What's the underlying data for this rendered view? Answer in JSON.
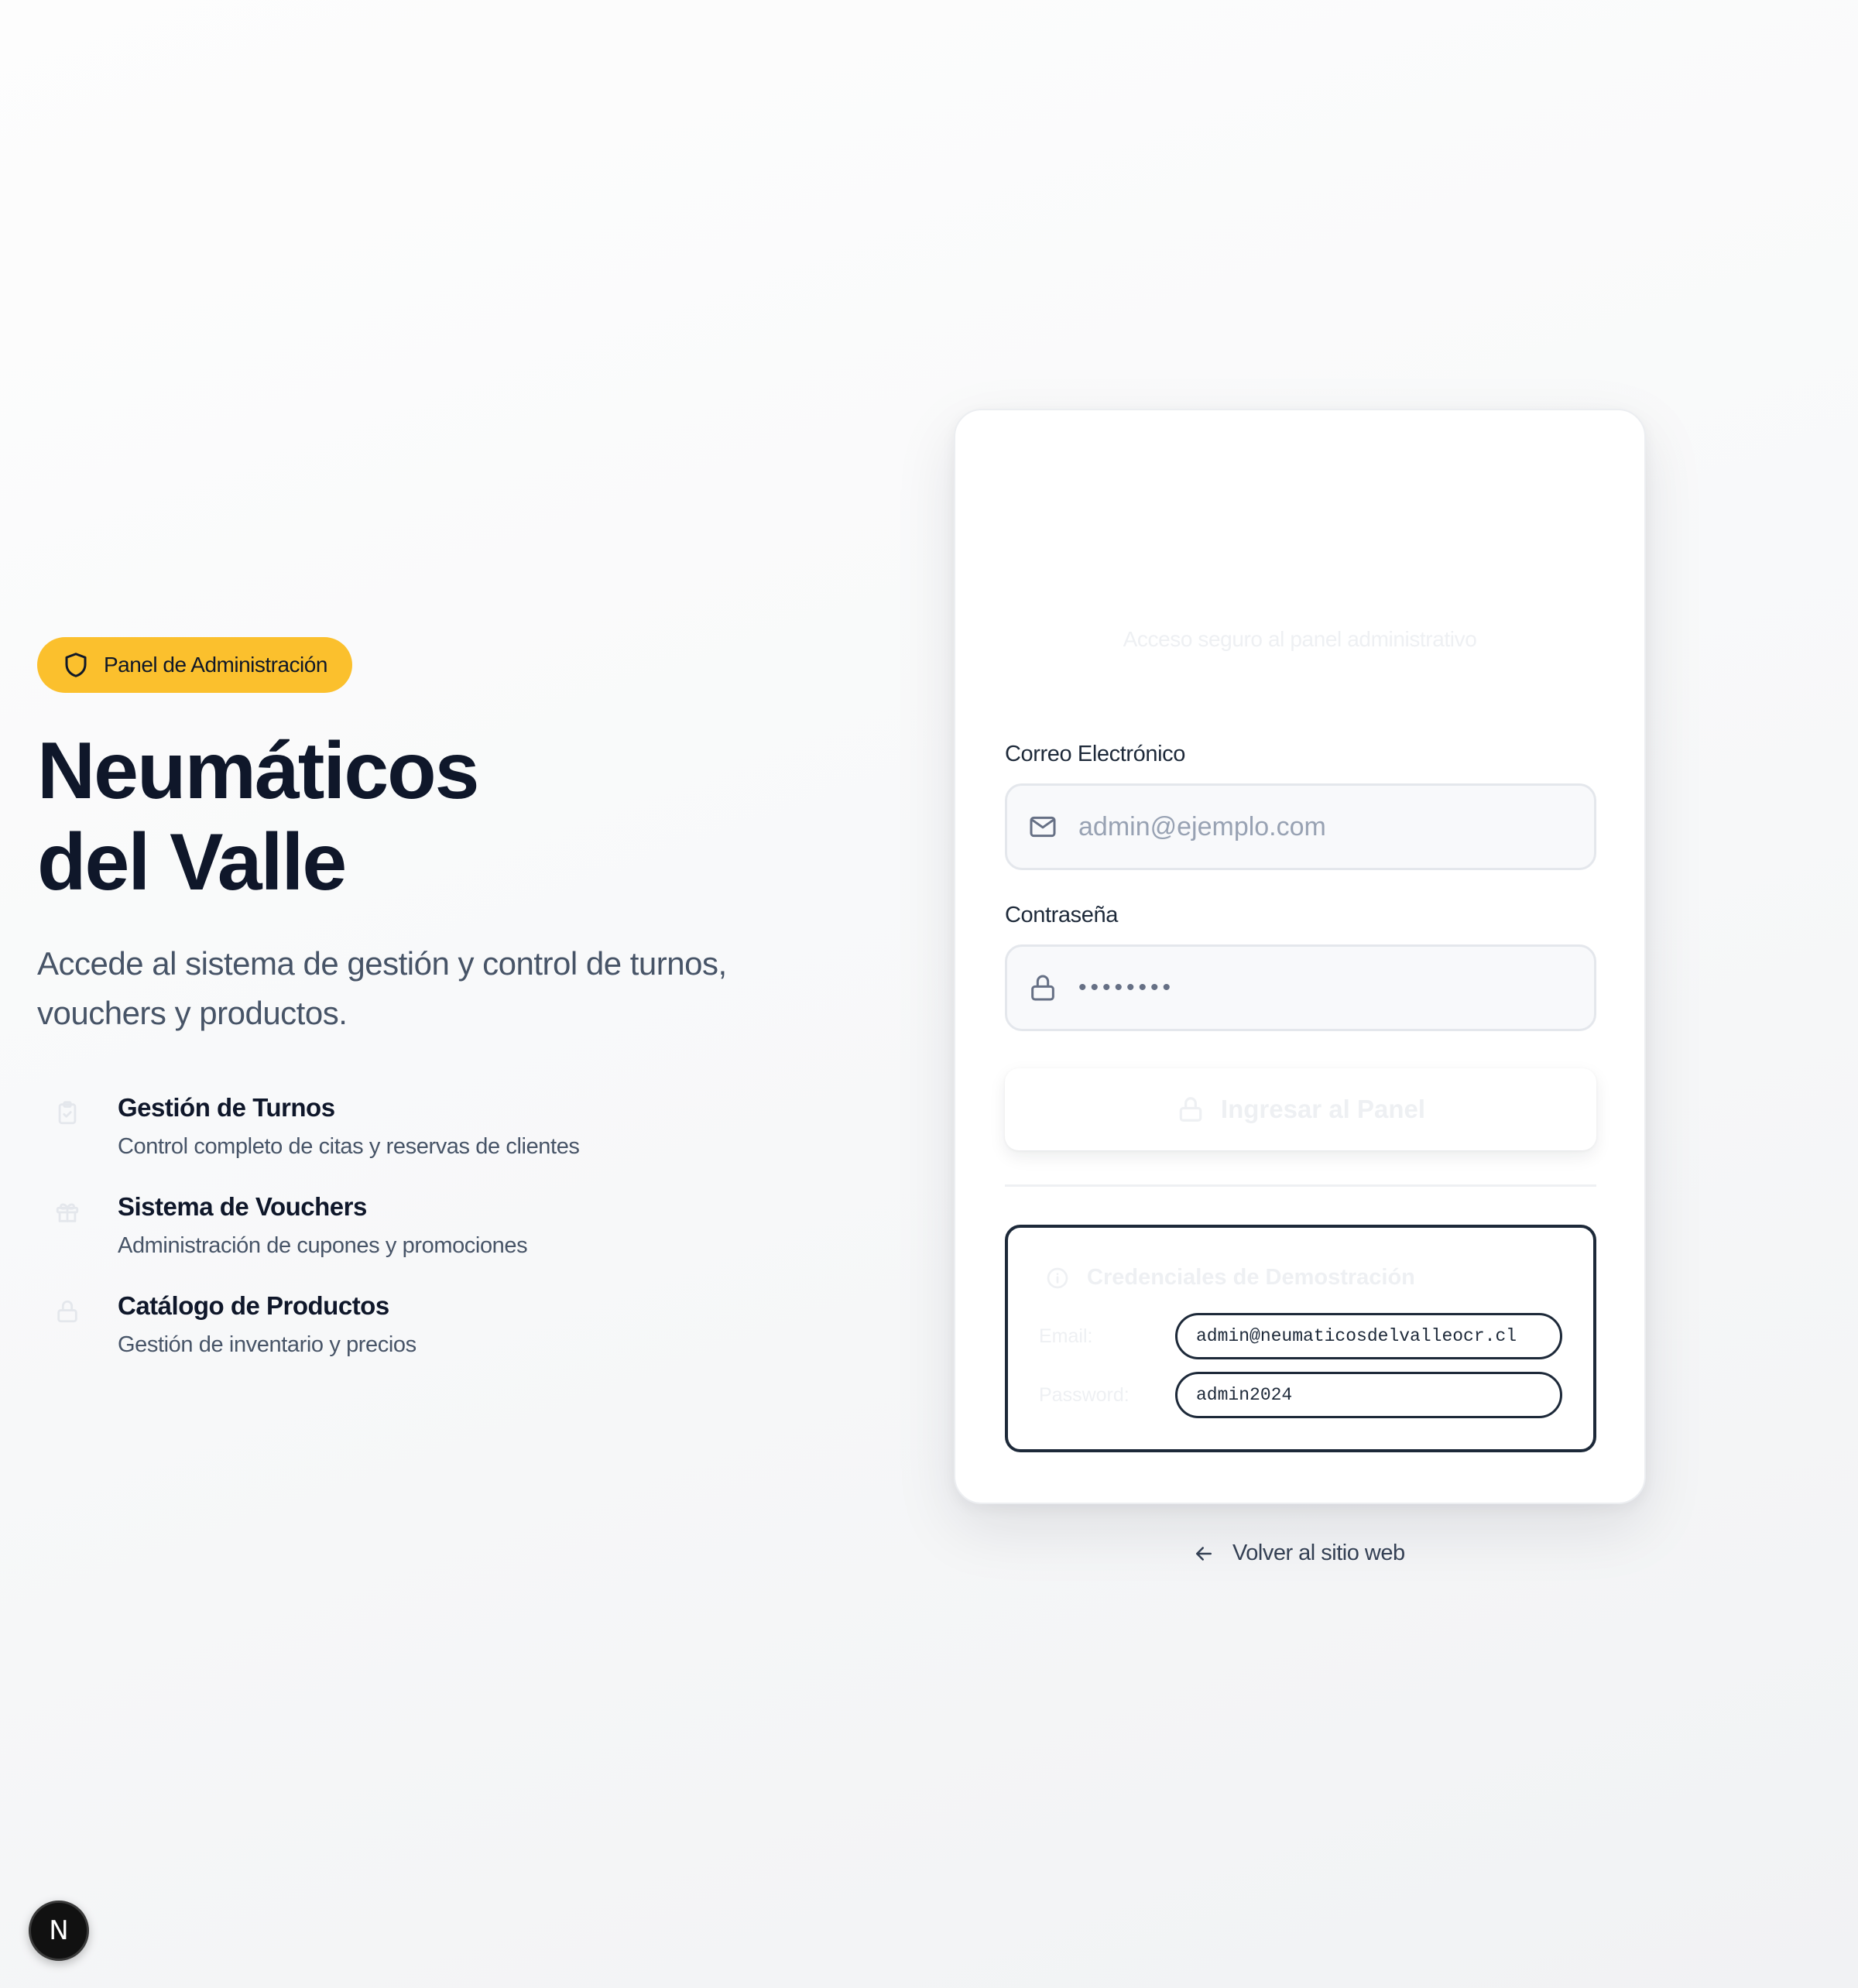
{
  "badge": {
    "label": "Panel de Administración",
    "icon": "shield-icon",
    "color": "#fbc02d"
  },
  "hero": {
    "title_line1": "Neumáticos",
    "title_line2": "del Valle",
    "subtitle": "Accede al sistema de gestión y control de turnos, vouchers y productos."
  },
  "features": [
    {
      "icon": "clipboard-check-icon",
      "title": "Gestión de Turnos",
      "description": "Control completo de citas y reservas de clientes"
    },
    {
      "icon": "gift-icon",
      "title": "Sistema de Vouchers",
      "description": "Administración de cupones y promociones"
    },
    {
      "icon": "lock-icon",
      "title": "Catálogo de Productos",
      "description": "Gestión de inventario y precios"
    }
  ],
  "login": {
    "subtitle": "Acceso seguro al panel administrativo",
    "email_label": "Correo Electrónico",
    "email_placeholder": "admin@ejemplo.com",
    "password_label": "Contraseña",
    "password_value": "••••••••",
    "submit_label": "Ingresar al Panel"
  },
  "demo": {
    "title": "Credenciales de Demostración",
    "email_label": "Email:",
    "email_value": "admin@neumaticosdelvalleocr.cl",
    "password_label": "Password:",
    "password_value": "admin2024"
  },
  "back_link": {
    "label": "Volver al sitio web"
  },
  "dev_badge": {
    "label": "N"
  }
}
